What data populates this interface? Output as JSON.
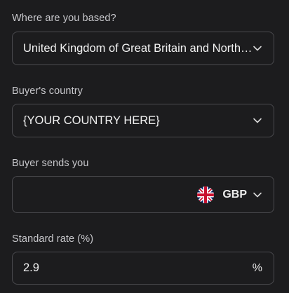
{
  "location": {
    "label": "Where are you based?",
    "value": "United Kingdom of Great Britain and Northern Ireland"
  },
  "buyer_country": {
    "label": "Buyer's country",
    "value": "{YOUR COUNTRY HERE}"
  },
  "buyer_sends": {
    "label": "Buyer sends you",
    "value": "",
    "currency_code": "GBP",
    "currency_flag_icon": "uk-flag-icon"
  },
  "standard_rate": {
    "label": "Standard rate (%)",
    "value": "2.9",
    "suffix": "%"
  },
  "colors": {
    "background": "#1c1c1e",
    "border": "#4a4a4e",
    "label": "#c8c8cc",
    "text": "#f2f2f2"
  }
}
